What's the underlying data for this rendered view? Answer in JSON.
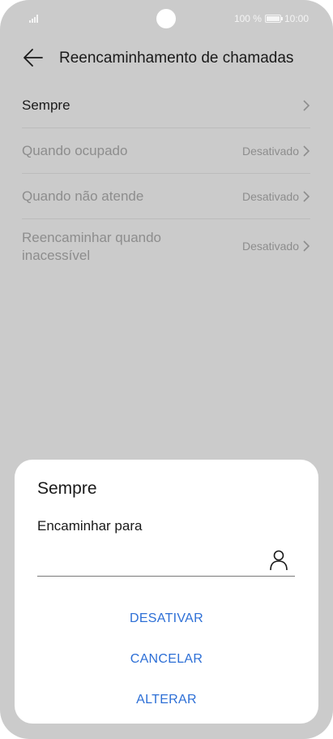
{
  "status_bar": {
    "battery_percent": "100 %",
    "time": "10:00",
    "icons": [
      "signal-icon",
      "camera-cutout",
      "battery-icon"
    ]
  },
  "header": {
    "title": "Reencaminhamento de chamadas",
    "back_icon": "arrow-left-icon"
  },
  "list": [
    {
      "label": "Sempre",
      "value": ""
    },
    {
      "label": "Quando ocupado",
      "value": "Desativado"
    },
    {
      "label": "Quando não atende",
      "value": "Desativado"
    },
    {
      "label": "Reencaminhar quando\ninacessível",
      "value": "Desativado"
    }
  ],
  "dialog": {
    "title": "Sempre",
    "field_label": "Encaminhar para",
    "field_value": "",
    "contact_icon": "person-icon",
    "buttons": {
      "disable": "DESATIVAR",
      "cancel": "CANCELAR",
      "change": "ALTERAR"
    }
  },
  "colors": {
    "accent": "#2d6fd6",
    "background_dimmed": "#cbcbcb",
    "dialog_bg": "#ffffff"
  }
}
